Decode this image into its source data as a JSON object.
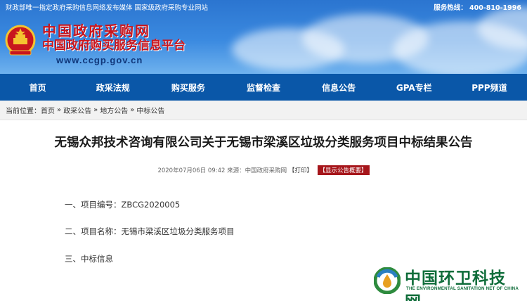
{
  "header": {
    "top_note": "财政部唯一指定政府采购信息网络发布媒体  国家级政府采购专业网站",
    "hotline": "服务热线： 400-810-1996",
    "title_line1": "中国政府采购网",
    "title_line2": "中国政府购买服务信息平台",
    "url": "www.ccgp.gov.cn",
    "emblem_icon": "national-emblem-icon"
  },
  "nav": {
    "items": [
      "首页",
      "政采法规",
      "购买服务",
      "监督检查",
      "信息公告",
      "GPA专栏",
      "PPP频道"
    ]
  },
  "breadcrumb": {
    "prefix": "当前位置：",
    "items": [
      "首页",
      "政采公告",
      "地方公告",
      "中标公告"
    ],
    "separator": "»"
  },
  "article": {
    "title": "无锡众邦技术咨询有限公司关于无锡市梁溪区垃圾分类服务项目中标结果公告",
    "meta_date": "2020年07月06日 09:42  来源：中国政府采购网",
    "print_label": "【打印】",
    "summary_label": "【显示公告概要】",
    "lines": [
      "一、项目编号：ZBCG2020005",
      "二、项目名称：无锡市梁溪区垃圾分类服务项目",
      "三、中标信息"
    ]
  },
  "watermark": {
    "name": "中国环卫科技网",
    "subtitle": "THE ENVIRONMENTAL SANITATION NET OF CHINA",
    "logo_icon": "sanitation-drop-logo-icon"
  },
  "colors": {
    "nav_bg": "#0a57a8",
    "title_red": "#c8161e",
    "summary_bg": "#a6161b",
    "watermark_green": "#0f6d3a"
  }
}
